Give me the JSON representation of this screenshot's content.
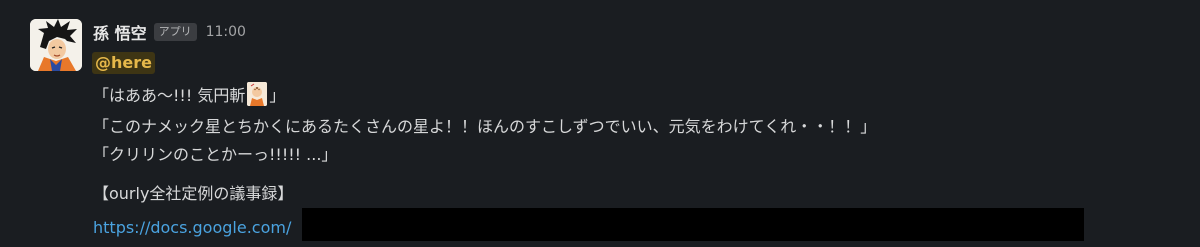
{
  "message": {
    "sender": "孫 悟空",
    "badge": "アプリ",
    "time": "11:00",
    "mention": "@here",
    "lines": [
      {
        "before": "「はああ〜!!! 気円斬",
        "after": "」"
      },
      "「このナメック星とちかくにあるたくさんの星よ！！ほんのすこしずつでいい、元気をわけてくれ・・！！」",
      "「クリリンのことかーっ!!!!! ...」",
      "【ourly全社定例の議事録】"
    ],
    "link_text": "https://docs.google.com/",
    "emoji_icon": "krillin-emoji-icon",
    "avatar_icon": "goku-avatar-icon"
  },
  "colors": {
    "background": "#1a1d21",
    "mention_text": "#e6b84a",
    "mention_bg": "#3e3514",
    "link": "#4aa3e0"
  }
}
